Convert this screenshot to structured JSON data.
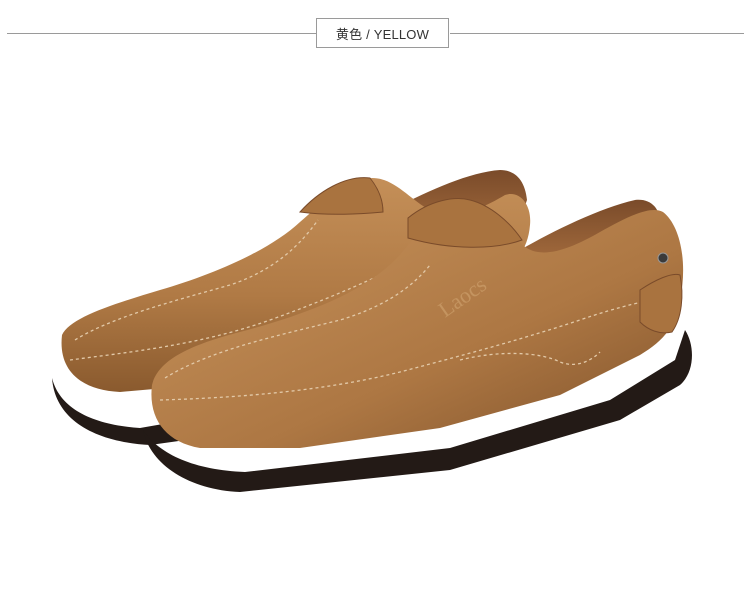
{
  "header": {
    "color_label": "黄色 / YELLOW"
  },
  "product": {
    "image": "pair-of-brown-suede-slip-on-loafers",
    "brand_embossing": "Laocs",
    "colors": {
      "upper": "#b07a45",
      "upper_shadow": "#8a5a2e",
      "sole": "#231a16",
      "stitching": "#e2c9a8"
    }
  }
}
